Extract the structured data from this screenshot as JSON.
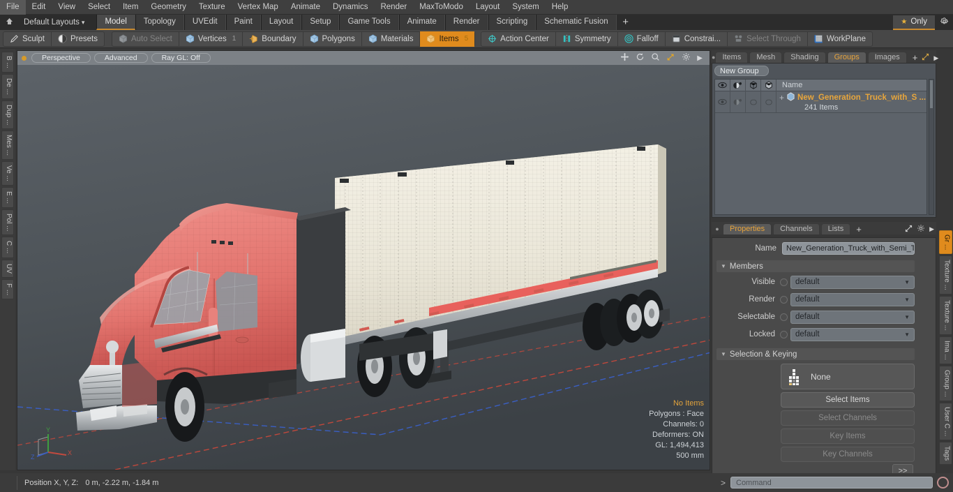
{
  "app": {
    "title": "Modo"
  },
  "menubar": {
    "items": [
      "File",
      "Edit",
      "View",
      "Select",
      "Item",
      "Geometry",
      "Texture",
      "Vertex Map",
      "Animate",
      "Dynamics",
      "Render",
      "MaxToModo",
      "Layout",
      "System",
      "Help"
    ]
  },
  "layoutbar": {
    "home_icon": "home-icon",
    "layouts_label": "Default Layouts",
    "layouts_caret": "▾",
    "tabs": [
      {
        "label": "Model",
        "active": true
      },
      {
        "label": "Topology",
        "active": false
      },
      {
        "label": "UVEdit",
        "active": false
      },
      {
        "label": "Paint",
        "active": false
      },
      {
        "label": "Layout",
        "active": false
      },
      {
        "label": "Setup",
        "active": false
      },
      {
        "label": "Game Tools",
        "active": false
      },
      {
        "label": "Animate",
        "active": false
      },
      {
        "label": "Render",
        "active": false
      },
      {
        "label": "Scripting",
        "active": false
      },
      {
        "label": "Schematic Fusion",
        "active": false
      }
    ],
    "add_label": "+",
    "only_label": "Only",
    "only_star": "★",
    "gear_icon": "gear-icon"
  },
  "modebar": {
    "left_group": [
      {
        "label": "Sculpt",
        "icon": "pencil-icon",
        "state": "normal"
      },
      {
        "label": "Presets",
        "icon": "sphere-icon",
        "state": "normal"
      }
    ],
    "select_group": [
      {
        "label": "Auto Select",
        "icon": "cube-grey-icon",
        "state": "dim",
        "badge": ""
      },
      {
        "label": "Vertices",
        "icon": "cube-blue-icon",
        "state": "normal",
        "badge": "1"
      },
      {
        "label": "Boundary",
        "icon": "cube-arrow-icon",
        "state": "normal",
        "badge": ""
      },
      {
        "label": "Polygons",
        "icon": "cube-blue-icon",
        "state": "normal",
        "badge": ""
      },
      {
        "label": "Materials",
        "icon": "cube-blue-icon",
        "state": "normal",
        "badge": ""
      },
      {
        "label": "Items",
        "icon": "cube-orange-icon",
        "state": "selected",
        "badge": "5"
      }
    ],
    "right_group": [
      {
        "label": "Action Center",
        "icon": "target-icon",
        "state": "normal"
      },
      {
        "label": "Symmetry",
        "icon": "symmetry-icon",
        "state": "normal"
      },
      {
        "label": "Falloff",
        "icon": "falloff-icon",
        "state": "normal"
      },
      {
        "label": "Constrai...",
        "icon": "constraint-icon",
        "state": "normal"
      },
      {
        "label": "Select Through",
        "icon": "select-through-icon",
        "state": "dim"
      },
      {
        "label": "WorkPlane",
        "icon": "workplane-icon",
        "state": "normal"
      }
    ]
  },
  "left_tabs": [
    "B ...",
    "De ...",
    "Dup ...",
    "Mes ...",
    "Ve ...",
    "E ...",
    "Pol ...",
    "C ...",
    "UV",
    "F ..."
  ],
  "viewport": {
    "pills": [
      "Perspective",
      "Advanced",
      "Ray GL: Off"
    ],
    "header_icons": [
      "move-icon",
      "rotate-icon",
      "zoom-icon",
      "fit-icon",
      "gear-icon",
      "chevron-right-icon"
    ],
    "stats": {
      "selection": "No Items",
      "polygons": "Polygons : Face",
      "channels": "Channels: 0",
      "deformers": "Deformers: ON",
      "gl": "GL: 1,494,413",
      "grid": "500 mm"
    },
    "axes": {
      "x": "X",
      "y": "Y",
      "z": "Z"
    },
    "colors": {
      "truck_body": "#e0706c",
      "truck_body_dark": "#cc4a46",
      "trailer": "#eeeade",
      "trailer_stripe": "#e8615c",
      "background": "#4e5459",
      "axis_x": "#c24a3f",
      "axis_y": "#3f9e3f",
      "axis_z": "#3b5fc0"
    }
  },
  "right_panel": {
    "top_tabs": [
      {
        "label": "Items",
        "active": false
      },
      {
        "label": "Mesh ...",
        "active": false
      },
      {
        "label": "Shading",
        "active": false
      },
      {
        "label": "Groups",
        "active": true
      },
      {
        "label": "Images",
        "active": false
      }
    ],
    "top_plus": "+",
    "groups": {
      "new_group_label": "New Group",
      "columns": [
        "eye-icon",
        "render-icon",
        "wireframe-icon",
        "shade-icon"
      ],
      "name_header": "Name",
      "rows": [
        {
          "expand": "+",
          "icon": "group-item-icon",
          "name": "New_Generation_Truck_with_S ...",
          "subtitle": "241 Items"
        }
      ]
    },
    "prop_tabs": [
      {
        "label": "Properties",
        "active": true
      },
      {
        "label": "Channels",
        "active": false
      },
      {
        "label": "Lists",
        "active": false
      }
    ],
    "prop_plus": "+",
    "prop_icons": [
      "expand-icon",
      "gear-icon",
      "chevron-right-icon"
    ],
    "properties": {
      "name_label": "Name",
      "name_value": "New_Generation_Truck_with_Semi_Tr",
      "members_header": "Members",
      "members": [
        {
          "label": "Visible",
          "value": "default"
        },
        {
          "label": "Render",
          "value": "default"
        },
        {
          "label": "Selectable",
          "value": "default"
        },
        {
          "label": "Locked",
          "value": "default"
        }
      ],
      "selection_header": "Selection & Keying",
      "none_label": "None",
      "buttons": [
        {
          "label": "Select Items",
          "enabled": true
        },
        {
          "label": "Select Channels",
          "enabled": false
        },
        {
          "label": "Key Items",
          "enabled": false
        },
        {
          "label": "Key Channels",
          "enabled": false
        }
      ],
      "more_label": ">>"
    }
  },
  "right_tabs": [
    {
      "label": "Gr ...",
      "active": true
    },
    {
      "label": "Texture ...",
      "active": false
    },
    {
      "label": "Texture ...",
      "active": false
    },
    {
      "label": "Ima ...",
      "active": false
    },
    {
      "label": "Group ...",
      "active": false
    },
    {
      "label": "User C ...",
      "active": false
    },
    {
      "label": "Tags",
      "active": false
    }
  ],
  "statusbar": {
    "position_label": "Position X, Y, Z:",
    "position_value": "0 m, -2.22 m, -1.84 m",
    "command_caret": ">",
    "command_placeholder": "Command",
    "record_icon": "record-icon"
  }
}
